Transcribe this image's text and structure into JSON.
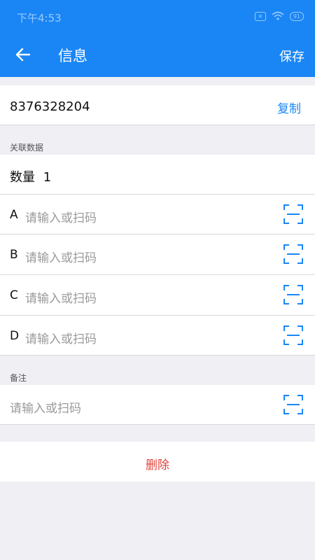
{
  "status_bar": {
    "time": "下午4:53",
    "battery": "91"
  },
  "header": {
    "title": "信息",
    "save_label": "保存"
  },
  "record": {
    "id": "8376328204",
    "copy_label": "复制"
  },
  "related": {
    "section_label": "关联数据",
    "quantity_label": "数量",
    "quantity_value": "1",
    "fields": [
      {
        "letter": "A",
        "placeholder": "请输入或扫码"
      },
      {
        "letter": "B",
        "placeholder": "请输入或扫码"
      },
      {
        "letter": "C",
        "placeholder": "请输入或扫码"
      },
      {
        "letter": "D",
        "placeholder": "请输入或扫码"
      }
    ]
  },
  "notes": {
    "section_label": "备注",
    "placeholder": "请输入或扫码"
  },
  "actions": {
    "delete_label": "删除"
  },
  "colors": {
    "primary": "#1a86f5",
    "danger": "#e0433c",
    "background": "#efeff4"
  }
}
